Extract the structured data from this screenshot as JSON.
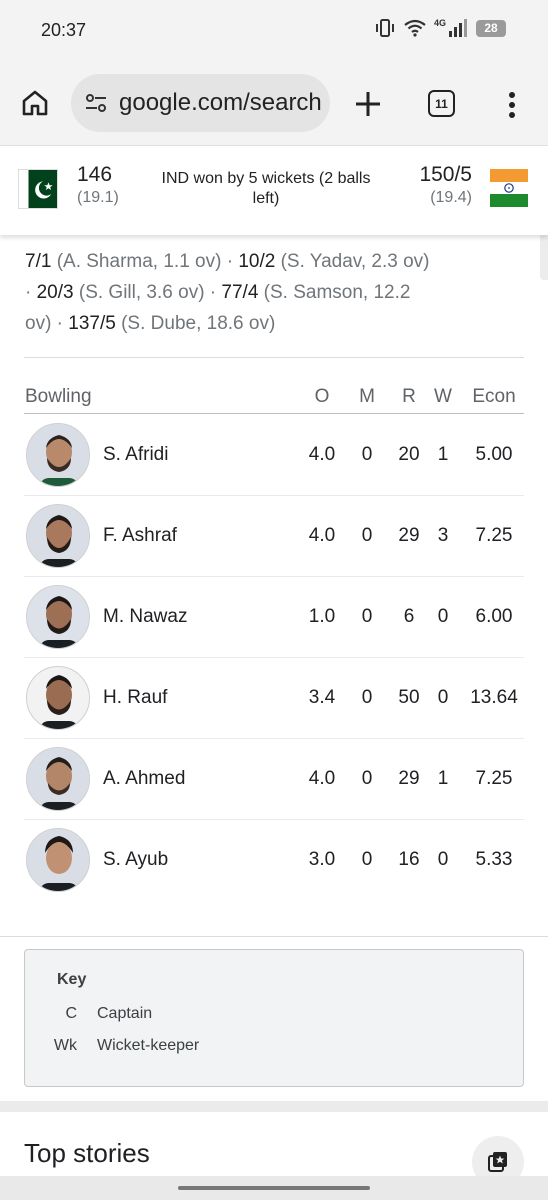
{
  "status_bar": {
    "time": "20:37",
    "network": "4G",
    "battery": "28"
  },
  "browser": {
    "url": "google.com/search",
    "tab_count": "11"
  },
  "match": {
    "team1": {
      "flag": "pakistan-flag",
      "score": "146",
      "overs": "(19.1)"
    },
    "team2": {
      "flag": "india-flag",
      "score": "150/5",
      "overs": "(19.4)"
    },
    "result": "IND won by 5 wickets (2 balls left)"
  },
  "fall_of_wickets": [
    {
      "score": "7/1",
      "detail": " (A. Sharma, 1.1 ov) · "
    },
    {
      "score": "10/2",
      "detail": " (S. Yadav, 2.3 ov) · "
    },
    {
      "score": "20/3",
      "detail": " (S. Gill, 3.6 ov) · "
    },
    {
      "score": "77/4",
      "detail": " (S. Samson, 12.2 ov) · "
    },
    {
      "score": "137/5",
      "detail": " (S. Dube, 18.6 ov)"
    }
  ],
  "bowling": {
    "headers": {
      "title": "Bowling",
      "o": "O",
      "m": "M",
      "r": "R",
      "w": "W",
      "econ": "Econ"
    },
    "rows": [
      {
        "name": "S. Afridi",
        "o": "4.0",
        "m": "0",
        "r": "20",
        "w": "1",
        "econ": "5.00"
      },
      {
        "name": "F. Ashraf",
        "o": "4.0",
        "m": "0",
        "r": "29",
        "w": "3",
        "econ": "7.25"
      },
      {
        "name": "M. Nawaz",
        "o": "1.0",
        "m": "0",
        "r": "6",
        "w": "0",
        "econ": "6.00"
      },
      {
        "name": "H. Rauf",
        "o": "3.4",
        "m": "0",
        "r": "50",
        "w": "0",
        "econ": "13.64"
      },
      {
        "name": "A. Ahmed",
        "o": "4.0",
        "m": "0",
        "r": "29",
        "w": "1",
        "econ": "7.25"
      },
      {
        "name": "S. Ayub",
        "o": "3.0",
        "m": "0",
        "r": "16",
        "w": "0",
        "econ": "5.33"
      }
    ]
  },
  "key": {
    "title": "Key",
    "items": [
      {
        "code": "C",
        "desc": "Captain"
      },
      {
        "code": "Wk",
        "desc": "Wicket-keeper"
      }
    ]
  },
  "top_stories": {
    "title": "Top stories"
  }
}
